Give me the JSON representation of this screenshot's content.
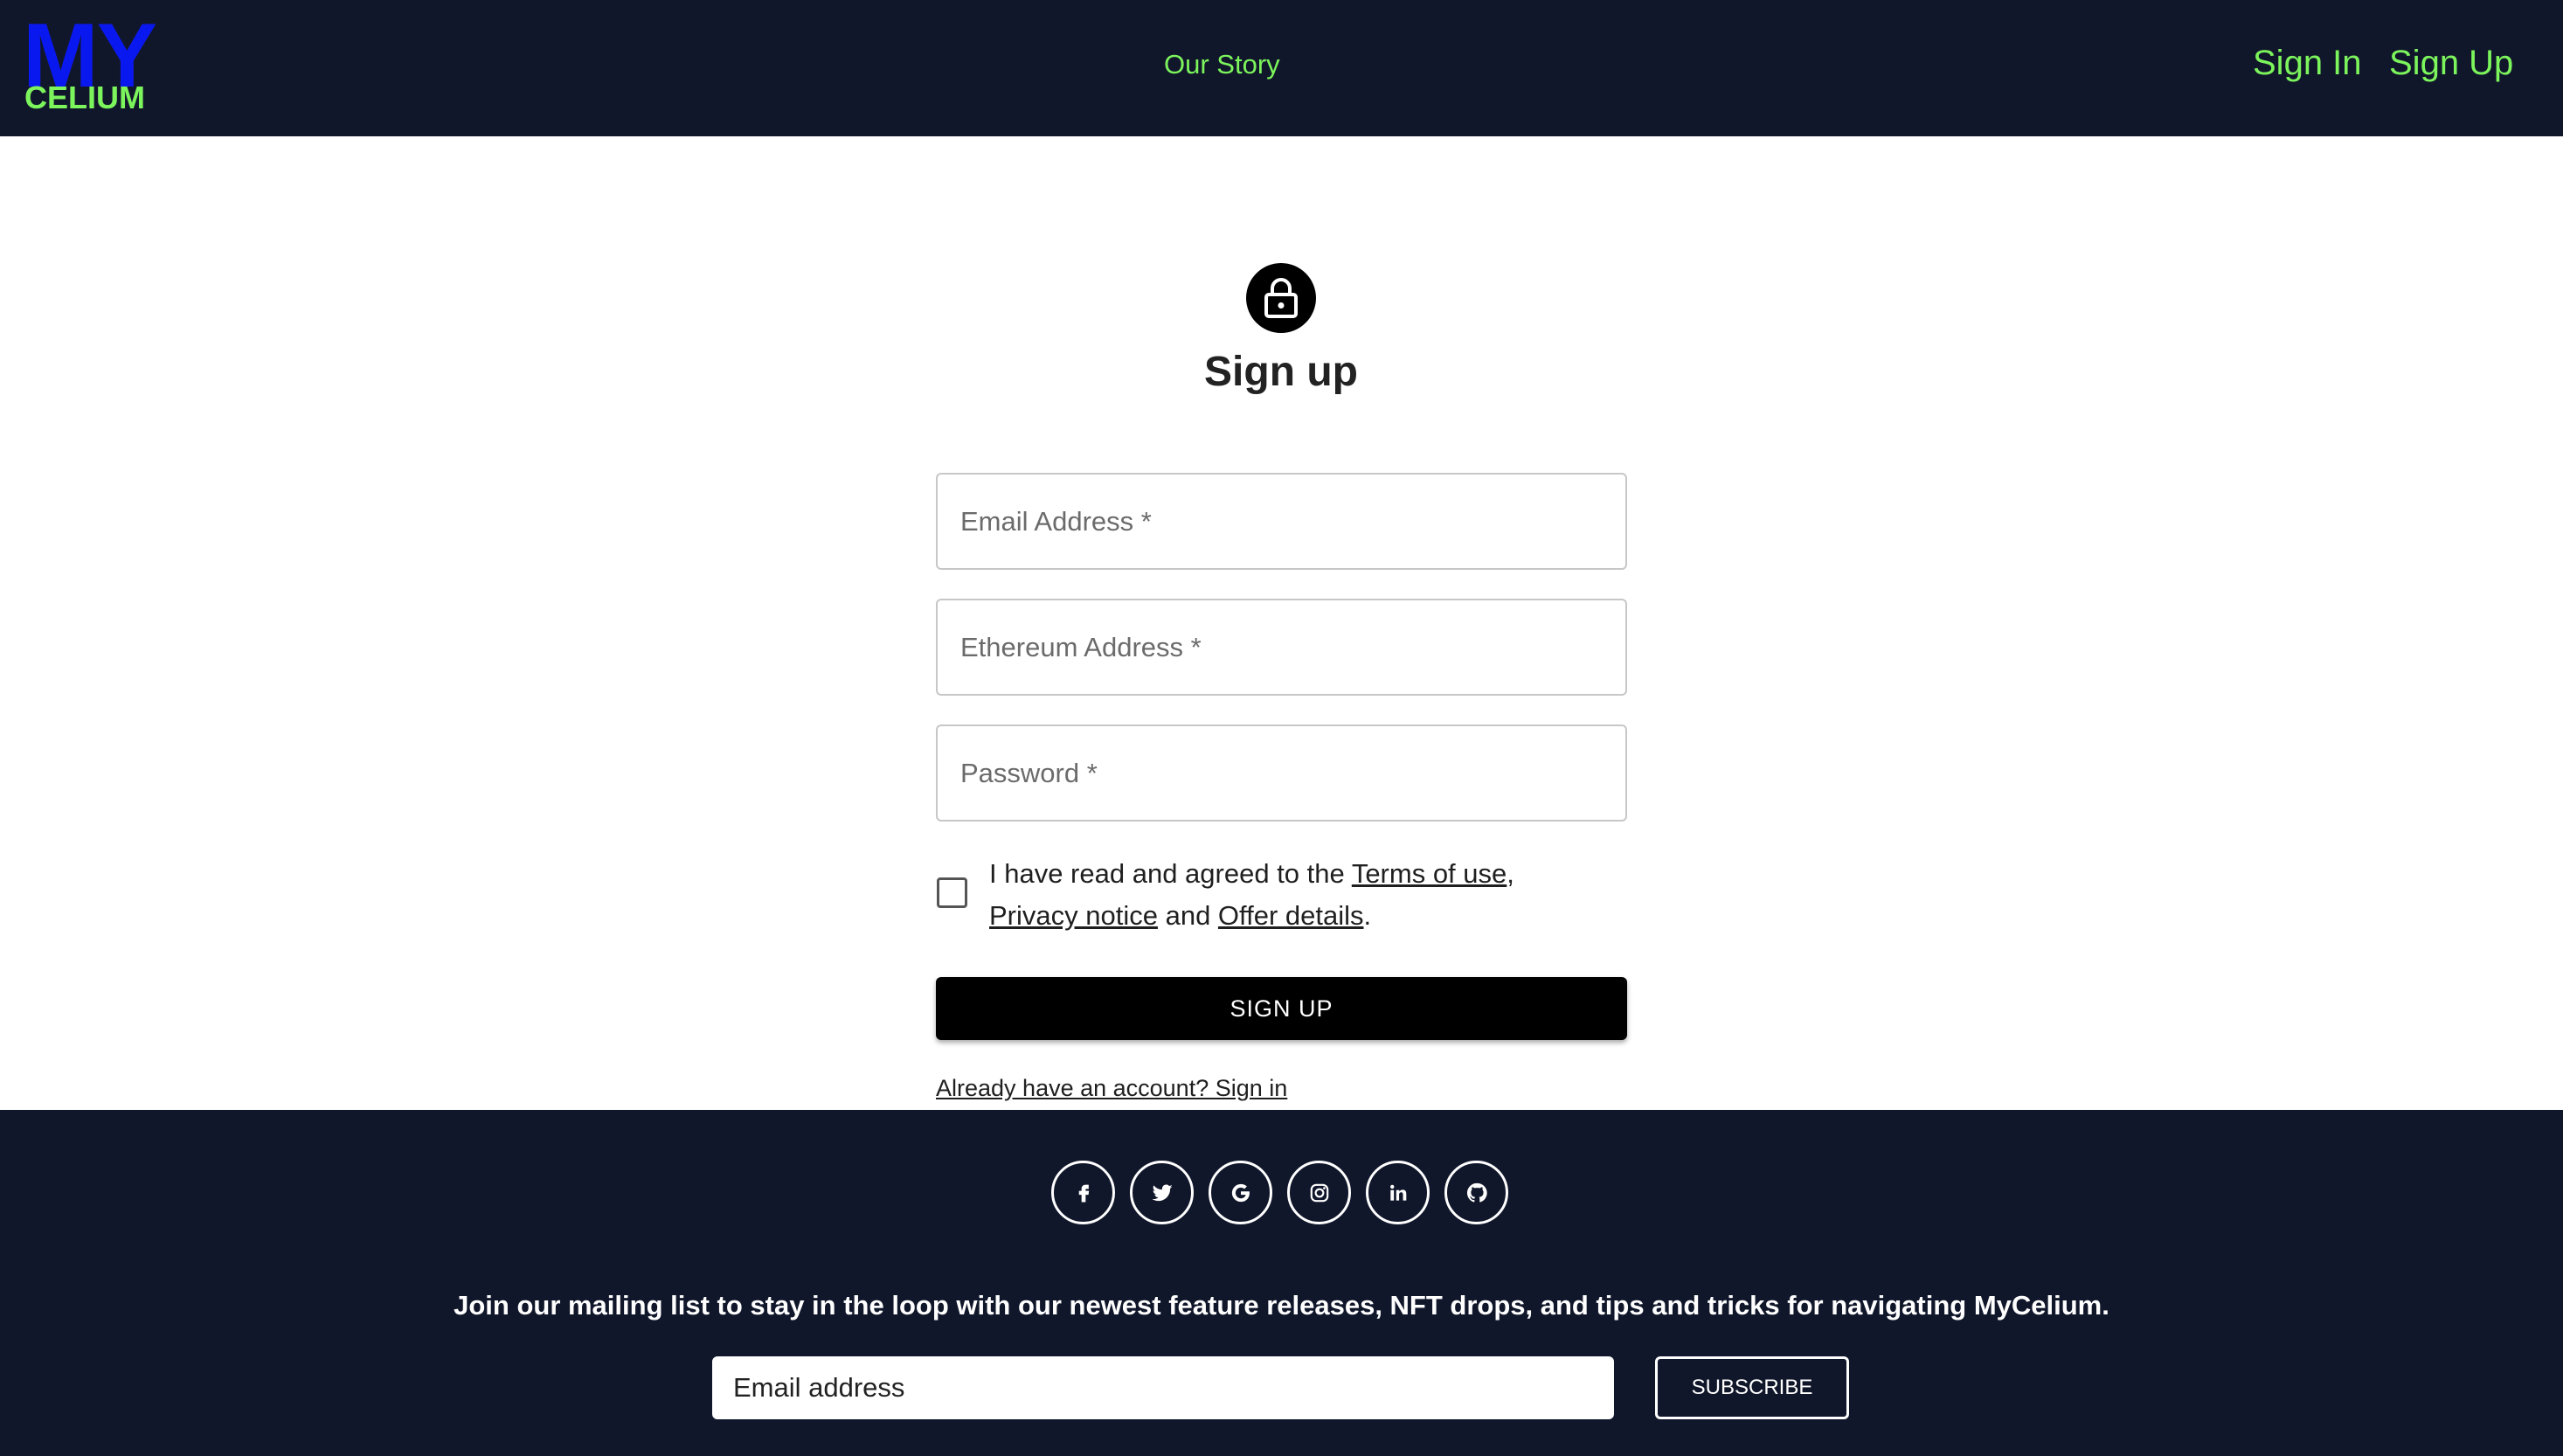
{
  "nav": {
    "logo_top": "MY",
    "logo_bottom": "CELIUM",
    "story_label": "Our Story",
    "signin_label": "Sign In",
    "signup_label": "Sign Up"
  },
  "form": {
    "icon": "lock-icon",
    "title": "Sign up",
    "email_placeholder": "Email Address *",
    "ethereum_placeholder": "Ethereum Address *",
    "password_placeholder": "Password *",
    "consent_prefix": "I have read and agreed to the ",
    "terms_label": "Terms of use",
    "consent_comma": ",",
    "privacy_label": "Privacy notice",
    "consent_and": " and ",
    "offer_label": "Offer details",
    "consent_period": ".",
    "submit_label": "SIGN UP",
    "signin_link": "Already have an account? Sign in"
  },
  "footer": {
    "social_icons": [
      "facebook-icon",
      "twitter-icon",
      "google-icon",
      "instagram-icon",
      "linkedin-icon",
      "github-icon"
    ],
    "mailing_text": "Join our mailing list to stay in the loop with our newest feature releases, NFT drops, and tips and tricks for navigating MyCelium.",
    "email_placeholder": "Email address",
    "subscribe_label": "SUBSCRIBE"
  },
  "colors": {
    "nav_bg": "#11172b",
    "accent_green": "#7cf55c",
    "logo_blue": "#0a18f0",
    "button_black": "#000000"
  }
}
